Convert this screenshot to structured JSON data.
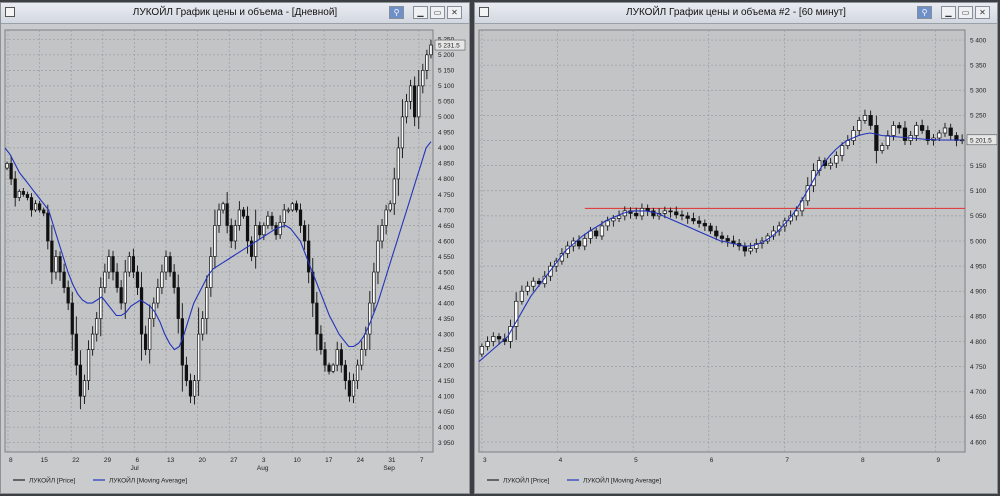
{
  "windows": [
    {
      "title": "ЛУКОЙЛ График цены и объема - [Дневной]",
      "buttons": [
        "pin",
        "minimize",
        "maximize",
        "close"
      ]
    },
    {
      "title": "ЛУКОЙЛ График цены и объема #2 - [60 минут]",
      "buttons": [
        "pin",
        "minimize",
        "maximize",
        "close"
      ]
    }
  ],
  "chart_data": [
    {
      "type": "candlestick",
      "title": "ЛУКОЙЛ График цены и объема - [Дневной]",
      "yticks": [
        "5 250",
        "5 200",
        "5 150",
        "5 100",
        "5 050",
        "5 000",
        "4 950",
        "4 900",
        "4 850",
        "4 800",
        "4 750",
        "4 700",
        "4 650",
        "4 600",
        "4 550",
        "4 500",
        "4 450",
        "4 400",
        "4 350",
        "4 300",
        "4 250",
        "4 200",
        "4 150",
        "4 100",
        "4 050",
        "4 000",
        "3 950"
      ],
      "ylim": [
        3920,
        5280
      ],
      "last_price_label": "5 231.5",
      "last_price": 5231.5,
      "xticks": [
        "8",
        "15",
        "22",
        "29",
        "6",
        "13",
        "20",
        "27",
        "3",
        "10",
        "17",
        "24",
        "31",
        "7"
      ],
      "month_labels": [
        {
          "label": "Jul",
          "tick": 4
        },
        {
          "label": "Aug",
          "tick": 8
        },
        {
          "label": "Sep",
          "tick": 12
        }
      ],
      "grid": true,
      "legend": [
        {
          "name": "ЛУКОЙЛ [Price]",
          "color": "#222222"
        },
        {
          "name": "ЛУКОЙЛ [Moving Average]",
          "color": "#2233bb"
        }
      ],
      "close": [
        4850,
        4800,
        4740,
        4760,
        4750,
        4740,
        4700,
        4720,
        4700,
        4690,
        4600,
        4500,
        4550,
        4500,
        4450,
        4400,
        4300,
        4200,
        4100,
        4150,
        4250,
        4300,
        4350,
        4450,
        4500,
        4550,
        4500,
        4450,
        4400,
        4500,
        4550,
        4500,
        4450,
        4300,
        4250,
        4350,
        4400,
        4450,
        4500,
        4550,
        4500,
        4450,
        4350,
        4200,
        4150,
        4100,
        4150,
        4300,
        4350,
        4450,
        4550,
        4650,
        4700,
        4720,
        4650,
        4600,
        4650,
        4700,
        4680,
        4600,
        4550,
        4650,
        4620,
        4650,
        4680,
        4650,
        4620,
        4660,
        4700,
        4700,
        4720,
        4700,
        4650,
        4600,
        4500,
        4400,
        4300,
        4250,
        4200,
        4180,
        4200,
        4250,
        4200,
        4150,
        4100,
        4150,
        4200,
        4250,
        4300,
        4400,
        4500,
        4600,
        4650,
        4700,
        4720,
        4800,
        4900,
        5000,
        5050,
        5100,
        5000,
        5100,
        5150,
        5200,
        5231.5
      ],
      "ma": [
        4900,
        4880,
        4850,
        4820,
        4800,
        4780,
        4760,
        4740,
        4720,
        4700,
        4650,
        4600,
        4550,
        4500,
        4460,
        4430,
        4410,
        4400,
        4400,
        4410,
        4420,
        4400,
        4380,
        4360,
        4360,
        4370,
        4390,
        4400,
        4410,
        4400,
        4390,
        4370,
        4340,
        4300,
        4270,
        4250,
        4260,
        4300,
        4350,
        4400,
        4430,
        4460,
        4490,
        4510,
        4520,
        4530,
        4540,
        4550,
        4560,
        4570,
        4580,
        4590,
        4600,
        4610,
        4620,
        4630,
        4640,
        4645,
        4650,
        4640,
        4620,
        4600,
        4560,
        4520,
        4480,
        4440,
        4400,
        4360,
        4330,
        4300,
        4280,
        4260,
        4260,
        4270,
        4290,
        4320,
        4360,
        4400,
        4450,
        4500,
        4550,
        4600,
        4650,
        4700,
        4750,
        4800,
        4850,
        4900,
        4920
      ]
    },
    {
      "type": "candlestick",
      "title": "ЛУКОЙЛ График цены и объема #2 - [60 минут]",
      "yticks": [
        "5 400",
        "5 350",
        "5 300",
        "5 250",
        "5 200",
        "5 150",
        "5 100",
        "5 050",
        "5 000",
        "4 950",
        "4 900",
        "4 850",
        "4 800",
        "4 750",
        "4 700",
        "4 650",
        "4 600"
      ],
      "ylim": [
        4580,
        5420
      ],
      "last_price_label": "5 201.5",
      "last_price": 5201.5,
      "xticks": [
        "3",
        "4",
        "5",
        "6",
        "7",
        "8",
        "9"
      ],
      "grid": true,
      "horizontal_line": {
        "value": 5065,
        "color": "#e03030"
      },
      "legend": [
        {
          "name": "ЛУКОЙЛ [Price]",
          "color": "#222222"
        },
        {
          "name": "ЛУКОЙЛ [Moving Average]",
          "color": "#2233bb"
        }
      ],
      "close": [
        4790,
        4800,
        4810,
        4805,
        4800,
        4830,
        4880,
        4900,
        4910,
        4920,
        4915,
        4930,
        4950,
        4960,
        4975,
        4990,
        5000,
        4990,
        5005,
        5020,
        5010,
        5030,
        5040,
        5045,
        5050,
        5060,
        5055,
        5050,
        5065,
        5060,
        5050,
        5055,
        5060,
        5058,
        5052,
        5050,
        5045,
        5040,
        5035,
        5030,
        5020,
        5010,
        5005,
        5000,
        4995,
        4990,
        4980,
        4985,
        4995,
        5000,
        5010,
        5020,
        5030,
        5040,
        5050,
        5060,
        5080,
        5110,
        5140,
        5160,
        5150,
        5155,
        5170,
        5190,
        5200,
        5220,
        5240,
        5250,
        5230,
        5180,
        5190,
        5210,
        5230,
        5225,
        5200,
        5210,
        5230,
        5220,
        5200,
        5205,
        5215,
        5225,
        5210,
        5200,
        5201.5
      ],
      "ma": [
        4760,
        4770,
        4780,
        4790,
        4800,
        4810,
        4830,
        4850,
        4870,
        4890,
        4905,
        4920,
        4935,
        4950,
        4965,
        4980,
        4990,
        5000,
        5010,
        5018,
        5025,
        5032,
        5040,
        5045,
        5050,
        5055,
        5058,
        5060,
        5060,
        5060,
        5058,
        5055,
        5050,
        5045,
        5040,
        5035,
        5030,
        5025,
        5020,
        5015,
        5010,
        5005,
        5000,
        4998,
        4995,
        4993,
        4990,
        4990,
        4992,
        4996,
        5002,
        5010,
        5020,
        5032,
        5045,
        5060,
        5078,
        5098,
        5118,
        5138,
        5155,
        5170,
        5182,
        5192,
        5200,
        5205,
        5210,
        5213,
        5215,
        5213,
        5210,
        5209,
        5208,
        5207,
        5206,
        5205,
        5204,
        5203,
        5202,
        5202,
        5201,
        5201,
        5201,
        5201,
        5201
      ]
    }
  ]
}
